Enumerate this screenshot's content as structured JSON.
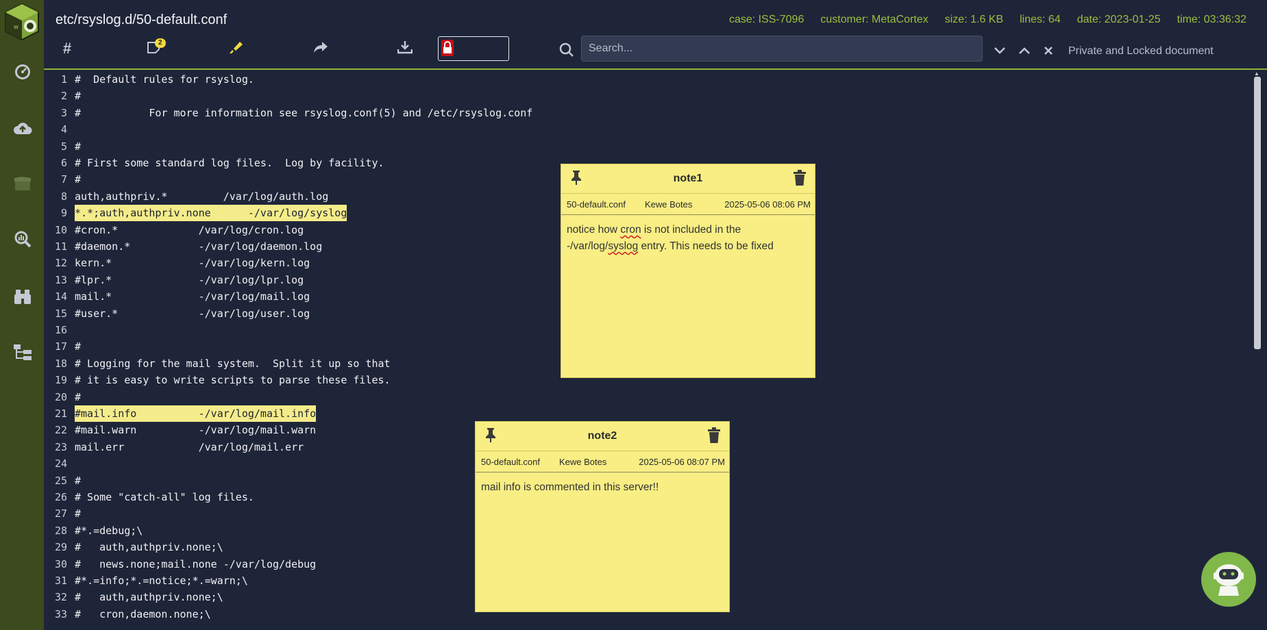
{
  "header": {
    "file_path": "etc/rsyslog.d/50-default.conf",
    "meta": {
      "case": "case: ISS-7096",
      "customer": "customer: MetaCortex",
      "size": "size: 1.6 KB",
      "lines": "lines: 64",
      "date": "date: 2023-01-25",
      "time": "time: 03:36:32"
    },
    "notes_badge": "2",
    "search_placeholder": "Search...",
    "doc_status": "Private and Locked document"
  },
  "sidebar": {
    "icons": [
      "dashboard-icon",
      "cloud-upload-icon",
      "box-icon",
      "analytics-search-icon",
      "binoculars-icon",
      "tree-icon"
    ]
  },
  "editor": {
    "lines": [
      {
        "n": "1",
        "text": "#  Default rules for rsyslog.",
        "hl": false
      },
      {
        "n": "2",
        "text": "#",
        "hl": false
      },
      {
        "n": "3",
        "text": "#           For more information see rsyslog.conf(5) and /etc/rsyslog.conf",
        "hl": false
      },
      {
        "n": "4",
        "text": "",
        "hl": false
      },
      {
        "n": "5",
        "text": "#",
        "hl": false
      },
      {
        "n": "6",
        "text": "# First some standard log files.  Log by facility.",
        "hl": false
      },
      {
        "n": "7",
        "text": "#",
        "hl": false
      },
      {
        "n": "8",
        "text": "auth,authpriv.*         /var/log/auth.log",
        "hl": false
      },
      {
        "n": "9",
        "text": "*.*;auth,authpriv.none      -/var/log/syslog",
        "hl": true
      },
      {
        "n": "10",
        "text": "#cron.*             /var/log/cron.log",
        "hl": false
      },
      {
        "n": "11",
        "text": "#daemon.*           -/var/log/daemon.log",
        "hl": false
      },
      {
        "n": "12",
        "text": "kern.*              -/var/log/kern.log",
        "hl": false
      },
      {
        "n": "13",
        "text": "#lpr.*              -/var/log/lpr.log",
        "hl": false
      },
      {
        "n": "14",
        "text": "mail.*              -/var/log/mail.log",
        "hl": false
      },
      {
        "n": "15",
        "text": "#user.*             -/var/log/user.log",
        "hl": false
      },
      {
        "n": "16",
        "text": "",
        "hl": false
      },
      {
        "n": "17",
        "text": "#",
        "hl": false
      },
      {
        "n": "18",
        "text": "# Logging for the mail system.  Split it up so that",
        "hl": false
      },
      {
        "n": "19",
        "text": "# it is easy to write scripts to parse these files.",
        "hl": false
      },
      {
        "n": "20",
        "text": "#",
        "hl": false
      },
      {
        "n": "21",
        "text": "#mail.info          -/var/log/mail.info",
        "hl": true
      },
      {
        "n": "22",
        "text": "#mail.warn          -/var/log/mail.warn",
        "hl": false
      },
      {
        "n": "23",
        "text": "mail.err            /var/log/mail.err",
        "hl": false
      },
      {
        "n": "24",
        "text": "",
        "hl": false
      },
      {
        "n": "25",
        "text": "#",
        "hl": false
      },
      {
        "n": "26",
        "text": "# Some \"catch-all\" log files.",
        "hl": false
      },
      {
        "n": "27",
        "text": "#",
        "hl": false
      },
      {
        "n": "28",
        "text": "#*.=debug;\\",
        "hl": false
      },
      {
        "n": "29",
        "text": "#   auth,authpriv.none;\\",
        "hl": false
      },
      {
        "n": "30",
        "text": "#   news.none;mail.none -/var/log/debug",
        "hl": false
      },
      {
        "n": "31",
        "text": "#*.=info;*.=notice;*.=warn;\\",
        "hl": false
      },
      {
        "n": "32",
        "text": "#   auth,authpriv.none;\\",
        "hl": false
      },
      {
        "n": "33",
        "text": "#   cron,daemon.none;\\",
        "hl": false
      }
    ]
  },
  "notes": [
    {
      "title": "note1",
      "file": "50-default.conf",
      "author": "Kewe Botes",
      "timestamp": "2025-05-06 08:06 PM",
      "body_parts": [
        "notice how ",
        "cron",
        " is not included in the",
        "-/var/log/",
        "syslog",
        " entry. This needs to be fixed"
      ]
    },
    {
      "title": "note2",
      "file": "50-default.conf",
      "author": "Kewe Botes",
      "timestamp": "2025-05-06 08:07 PM",
      "body": "mail info is commented in this server!!"
    }
  ],
  "colors": {
    "sidebar": "#3c4a1e",
    "background": "#1f2538",
    "accent": "#9bbf3d",
    "note": "#f8ee84",
    "highlight": "#f4ec8a",
    "lock": "#c8101c",
    "bot": "#80b84a"
  }
}
